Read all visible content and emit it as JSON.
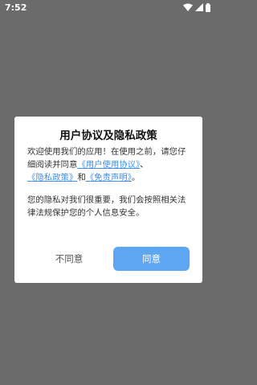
{
  "status_bar": {
    "time": "7:52",
    "icons": [
      "wifi-icon",
      "signal-icon",
      "battery-icon"
    ]
  },
  "dialog": {
    "title": "用户协议及隐私政策",
    "paragraph1": {
      "text_before": "欢迎使用我们的应用！在使用之前，请您仔细阅读并同意",
      "link_user_agreement": "《用户使用协议》",
      "separator1": "、",
      "link_privacy_policy": "《隐私政策》",
      "separator2": "和",
      "link_disclaimer": "《免责声明》",
      "text_after": "。"
    },
    "paragraph2": "您的隐私对我们很重要，我们会按照相关法律法规保护您的个人信息安全。",
    "disagree_label": "不同意",
    "agree_label": "同意"
  },
  "colors": {
    "backdrop": "#6b6b6b",
    "link": "#3d8fe8",
    "agree_button": "#5da6f3"
  }
}
